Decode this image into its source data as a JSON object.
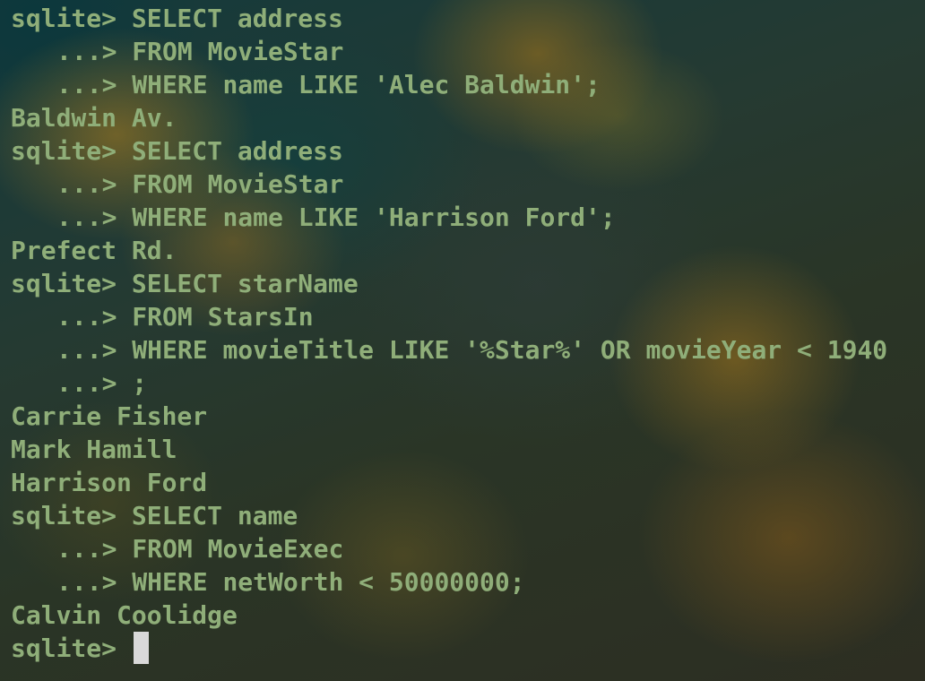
{
  "terminal": {
    "prompt": "sqlite> ",
    "continuation": "...> ",
    "lines": [
      {
        "kind": "prompt",
        "text": "SELECT address"
      },
      {
        "kind": "cont",
        "text": "FROM MovieStar"
      },
      {
        "kind": "cont",
        "text": "WHERE name LIKE 'Alec Baldwin';"
      },
      {
        "kind": "output",
        "text": "Baldwin Av."
      },
      {
        "kind": "prompt",
        "text": "SELECT address"
      },
      {
        "kind": "cont",
        "text": "FROM MovieStar"
      },
      {
        "kind": "cont",
        "text": "WHERE name LIKE 'Harrison Ford';"
      },
      {
        "kind": "output",
        "text": "Prefect Rd."
      },
      {
        "kind": "prompt",
        "text": "SELECT starName"
      },
      {
        "kind": "cont",
        "text": "FROM StarsIn"
      },
      {
        "kind": "cont",
        "text": "WHERE movieTitle LIKE '%Star%' OR movieYear < 1940"
      },
      {
        "kind": "cont",
        "text": ";"
      },
      {
        "kind": "output",
        "text": "Carrie Fisher"
      },
      {
        "kind": "output",
        "text": "Mark Hamill"
      },
      {
        "kind": "output",
        "text": "Harrison Ford"
      },
      {
        "kind": "prompt",
        "text": "SELECT name"
      },
      {
        "kind": "cont",
        "text": "FROM MovieExec"
      },
      {
        "kind": "cont",
        "text": "WHERE netWorth < 50000000;"
      },
      {
        "kind": "output",
        "text": "Calvin Coolidge"
      },
      {
        "kind": "input",
        "text": ""
      }
    ],
    "text_color": "#8fae79",
    "cursor_color": "#d9d9d9"
  }
}
